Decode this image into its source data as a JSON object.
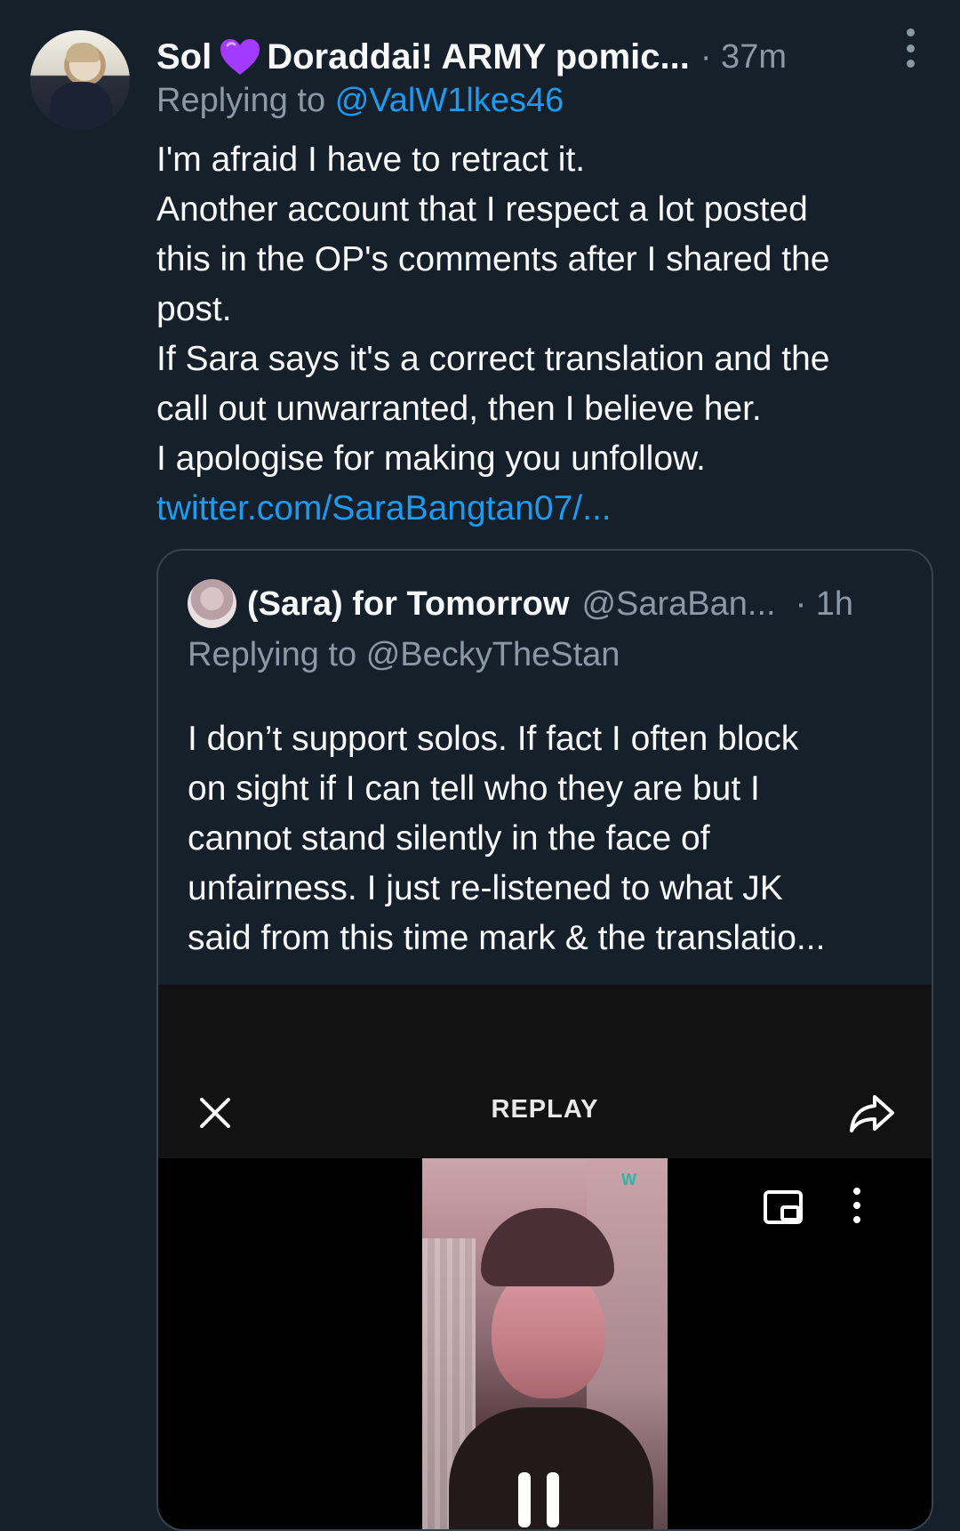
{
  "tweet": {
    "author_name_part1": "Sol",
    "author_name_part2": "Doraddai! ARMY pomic...",
    "time": "· 37m",
    "replying_prefix": "Replying to",
    "replying_to": "@ValW1lkes46",
    "text_lines": [
      "I'm afraid I have to retract it.",
      "Another account that I respect a lot posted",
      "this in the OP's comments after I shared the",
      "post.",
      "If Sara says it's a correct translation and the",
      "call out unwarranted,  then I believe her.",
      "I apologise for making you unfollow."
    ],
    "link": "twitter.com/SaraBangtan07/..."
  },
  "quote": {
    "author_name": "(Sara) for Tomorrow",
    "handle": "@SaraBan...",
    "time": "· 1h",
    "replying_prefix": "Replying to",
    "replying_to": "@BeckyTheStan",
    "text_lines": [
      "I don’t support solos. If fact I often block",
      "on sight if I can tell who they are but I",
      "cannot stand silently in the face of",
      "unfairness. I just re-listened to what JK",
      "said from this time mark & the translatio..."
    ]
  },
  "video": {
    "replay_label": "REPLAY",
    "watermark": "W"
  },
  "colors": {
    "background": "#15202b",
    "text": "#f7f9f9",
    "secondary": "#8b98a5",
    "accent": "#1d9bf0",
    "border": "#38444d",
    "heart": "#a23bff"
  },
  "icons": {
    "more": "more-vertical-icon",
    "heart": "purple-heart-icon",
    "close": "close-icon",
    "share": "share-icon",
    "pip": "picture-in-picture-icon",
    "pause": "pause-icon"
  }
}
